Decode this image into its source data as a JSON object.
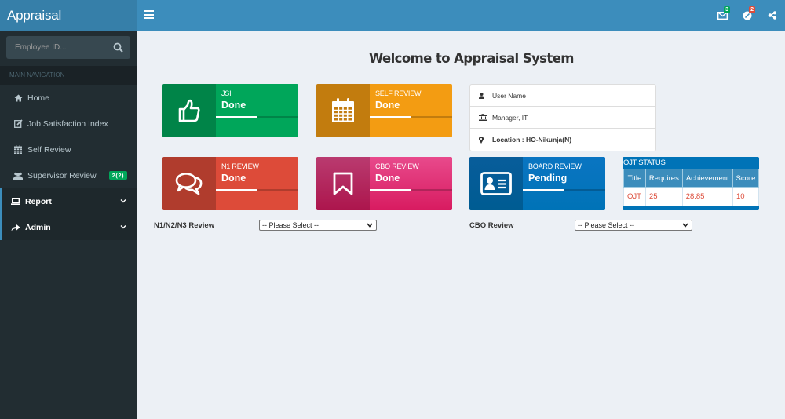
{
  "app": {
    "logo": "Appraisal"
  },
  "header": {
    "notifications": [
      {
        "icon": "envelope-icon",
        "count": "3",
        "color": "#00a65a"
      },
      {
        "icon": "tasks-icon",
        "count": "2",
        "color": "#dd4b39"
      }
    ],
    "share_icon": "share-alt-icon"
  },
  "sidebar": {
    "search_placeholder": "Employee ID...",
    "nav_header": "MAIN NAVIGATION",
    "items": [
      {
        "label": "Home",
        "icon": "home-icon"
      },
      {
        "label": "Job Satisfaction Index",
        "icon": "edit-icon"
      },
      {
        "label": "Self Review",
        "icon": "calendar-icon"
      },
      {
        "label": "Supervisor Review",
        "icon": "users-icon",
        "badge": "2(2)"
      },
      {
        "label": "Report",
        "icon": "laptop-icon",
        "expandable": true
      },
      {
        "label": "Admin",
        "icon": "share-icon",
        "expandable": true
      }
    ]
  },
  "main": {
    "title": "Welcome to Appraisal System",
    "cards": [
      {
        "label": "JSI",
        "value": "Done",
        "icon": "thumbs-up-icon",
        "color": "#00a65a",
        "progress": 0.5
      },
      {
        "label": "SELF REVIEW",
        "value": "Done",
        "icon": "calendar-icon",
        "color": "#f39c12",
        "progress": 0.5
      },
      {
        "label": "N1 REVIEW",
        "value": "Done",
        "icon": "comments-icon",
        "color": "#dd4b39",
        "progress": 0.5
      },
      {
        "label": "CBO REVIEW",
        "value": "Done",
        "icon": "bookmark-icon",
        "color": "#d81b60",
        "progress": 0.5
      },
      {
        "label": "BOARD REVIEW",
        "value": "Pending",
        "icon": "id-card-icon",
        "color": "#0073b7",
        "progress": 0.5
      }
    ],
    "user_info": {
      "name": "User Name",
      "designation": "Manager,  IT",
      "location": "Location : HO-Nikunja(N)"
    },
    "ojt_status": {
      "title": "OJT STATUS",
      "columns": [
        "Title",
        "Requires",
        "Achievement",
        "Score"
      ],
      "rows": [
        [
          "OJT",
          "25",
          "28.85",
          "10"
        ]
      ]
    },
    "filters": [
      {
        "label": "N1/N2/N3 Review",
        "selected": "-- Please Select --"
      },
      {
        "label": "CBO Review",
        "selected": "-- Please Select --"
      }
    ]
  }
}
